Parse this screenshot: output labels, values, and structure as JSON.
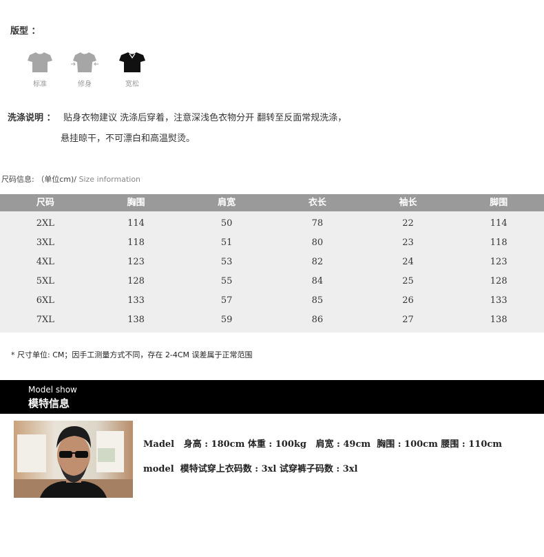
{
  "fit": {
    "label": "版型 ：",
    "options": [
      {
        "label": "标准",
        "active": false
      },
      {
        "label": "修身",
        "active": false
      },
      {
        "label": "宽松",
        "active": true
      }
    ],
    "colors": {
      "inactive": "#a6a6a6",
      "active": "#111111"
    }
  },
  "wash": {
    "label": "洗涤说明 ：",
    "line1": "贴身衣物建议 洗涤后穿着，注意深浅色衣物分开 翻转至反面常规洗涤，",
    "line2": "悬挂晾干，不可漂白和高温熨烫。"
  },
  "size_info": {
    "label": "尺码信息: （单位cm)/",
    "label_en": " Size information"
  },
  "size_table": {
    "headers": [
      "尺码",
      "胸围",
      "肩宽",
      "衣长",
      "袖长",
      "脚围"
    ],
    "rows": [
      [
        "2XL",
        "114",
        "50",
        "78",
        "22",
        "114"
      ],
      [
        "3XL",
        "118",
        "51",
        "80",
        "23",
        "118"
      ],
      [
        "4XL",
        "123",
        "53",
        "82",
        "24",
        "123"
      ],
      [
        "5XL",
        "128",
        "55",
        "84",
        "25",
        "128"
      ],
      [
        "6XL",
        "133",
        "57",
        "85",
        "26",
        "133"
      ],
      [
        "7XL",
        "138",
        "59",
        "86",
        "27",
        "138"
      ]
    ],
    "colors": {
      "header_bg": "#9a9a9a",
      "body_bg": "#eeeeee"
    }
  },
  "note": "* 尺寸单位: CM；因手工测量方式不同，存在 2-4CM 误差属于正常范围",
  "model": {
    "banner_en": "Model show",
    "banner_zh": "模特信息",
    "line1": "Madel   身高 : 180cm 体重 : 100kg   肩宽 : 49cm  胸围 : 100cm 腰围 : 110cm",
    "line2": "model  模特试穿上衣码数 : 3xl 试穿裤子码数 : 3xl"
  }
}
